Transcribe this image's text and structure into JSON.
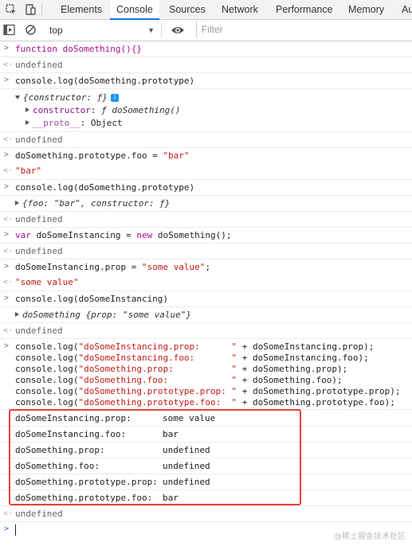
{
  "toolbar": {
    "tabs": [
      "Elements",
      "Console",
      "Sources",
      "Network",
      "Performance",
      "Memory",
      "Au"
    ],
    "active_tab": "Console",
    "context": "top",
    "filter_placeholder": "Filter"
  },
  "console": {
    "l1": "function doSomething(){}",
    "l2": "undefined",
    "l3": "console.log(doSomething.prototype)",
    "obj1_header": "{constructor: ƒ}",
    "obj1_constructor_key": "constructor",
    "obj1_constructor_val": "ƒ doSomething()",
    "obj1_proto_key": "__proto__",
    "obj1_proto_val": "Object",
    "l4": "undefined",
    "l5_a": "doSomething.prototype.foo = ",
    "l5_b": "\"bar\"",
    "l6": "\"bar\"",
    "l7": "console.log(doSomething.prototype)",
    "obj2": "{foo: \"bar\", constructor: ƒ}",
    "l8": "undefined",
    "l9_a": "var",
    "l9_b": " doSomeInstancing = ",
    "l9_c": "new",
    "l9_d": " doSomething();",
    "l10": "undefined",
    "l11_a": "doSomeInstancing.prop = ",
    "l11_b": "\"some value\"",
    "l11_c": ";",
    "l12": "\"some value\"",
    "l13": "console.log(doSomeInstancing)",
    "obj3_name": "doSomething",
    "obj3_body_a": " {prop: ",
    "obj3_body_b": "\"some value\"",
    "obj3_body_c": "}",
    "l14": "undefined",
    "multi": [
      {
        "pre": "console.log(",
        "str": "\"doSomeInstancing.prop:      \"",
        "post": " + doSomeInstancing.prop);"
      },
      {
        "pre": "console.log(",
        "str": "\"doSomeInstancing.foo:       \"",
        "post": " + doSomeInstancing.foo);"
      },
      {
        "pre": "console.log(",
        "str": "\"doSomething.prop:           \"",
        "post": " + doSomething.prop);"
      },
      {
        "pre": "console.log(",
        "str": "\"doSomething.foo:            \"",
        "post": " + doSomething.foo);"
      },
      {
        "pre": "console.log(",
        "str": "\"doSomething.prototype.prop: \"",
        "post": " + doSomething.prototype.prop);"
      },
      {
        "pre": "console.log(",
        "str": "\"doSomething.prototype.foo:  \"",
        "post": " + doSomething.prototype.foo);"
      }
    ],
    "outputs": [
      {
        "k": "doSomeInstancing.prop:",
        "v": "some value"
      },
      {
        "k": "doSomeInstancing.foo:",
        "v": "bar"
      },
      {
        "k": "doSomething.prop:",
        "v": "undefined"
      },
      {
        "k": "doSomething.foo:",
        "v": "undefined"
      },
      {
        "k": "doSomething.prototype.prop:",
        "v": "undefined"
      },
      {
        "k": "doSomething.prototype.foo:",
        "v": "bar"
      }
    ],
    "l15": "undefined",
    "watermark": "@稀土掘金技术社区"
  },
  "colors": {
    "accent": "#1a73e8",
    "highlight_box": "#e8413a"
  }
}
